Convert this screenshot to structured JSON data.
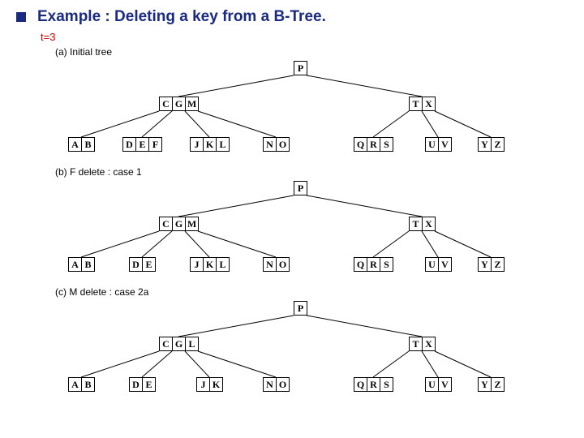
{
  "title": "Example : Deleting a key from a B-Tree.",
  "param": "t=3",
  "captions": {
    "a": "(a) Initial tree",
    "b": "(b) F delete : case 1",
    "c": "(c) M delete : case 2a"
  },
  "trees": {
    "a": {
      "root": [
        "P"
      ],
      "int": [
        [
          "C",
          "G",
          "M"
        ],
        [
          "T",
          "X"
        ]
      ],
      "leaves": [
        [
          "A",
          "B"
        ],
        [
          "D",
          "E",
          "F"
        ],
        [
          "J",
          "K",
          "L"
        ],
        [
          "N",
          "O"
        ],
        [
          "Q",
          "R",
          "S"
        ],
        [
          "U",
          "V"
        ],
        [
          "Y",
          "Z"
        ]
      ]
    },
    "b": {
      "root": [
        "P"
      ],
      "int": [
        [
          "C",
          "G",
          "M"
        ],
        [
          "T",
          "X"
        ]
      ],
      "leaves": [
        [
          "A",
          "B"
        ],
        [
          "D",
          "E"
        ],
        [
          "J",
          "K",
          "L"
        ],
        [
          "N",
          "O"
        ],
        [
          "Q",
          "R",
          "S"
        ],
        [
          "U",
          "V"
        ],
        [
          "Y",
          "Z"
        ]
      ]
    },
    "c": {
      "root": [
        "P"
      ],
      "int": [
        [
          "C",
          "G",
          "L"
        ],
        [
          "T",
          "X"
        ]
      ],
      "leaves": [
        [
          "A",
          "B"
        ],
        [
          "D",
          "E"
        ],
        [
          "J",
          "K"
        ],
        [
          "N",
          "O"
        ],
        [
          "Q",
          "R",
          "S"
        ],
        [
          "U",
          "V"
        ],
        [
          "Y",
          "Z"
        ]
      ]
    }
  }
}
